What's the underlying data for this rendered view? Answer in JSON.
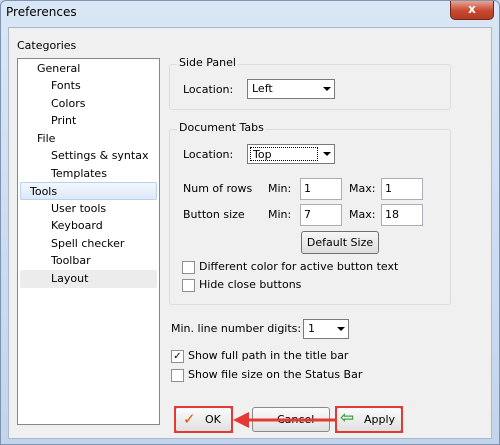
{
  "window": {
    "title": "Preferences",
    "close_glyph": "x"
  },
  "categories": {
    "label": "Categories",
    "items": [
      {
        "label": "General"
      },
      {
        "label": "Fonts"
      },
      {
        "label": "Colors"
      },
      {
        "label": "Print"
      },
      {
        "label": "File"
      },
      {
        "label": "Settings & syntax"
      },
      {
        "label": "Templates"
      },
      {
        "label": "Tools"
      },
      {
        "label": "User tools"
      },
      {
        "label": "Keyboard"
      },
      {
        "label": "Spell checker"
      },
      {
        "label": "Toolbar"
      },
      {
        "label": "Layout"
      }
    ]
  },
  "side_panel": {
    "title": "Side Panel",
    "location_label": "Location:",
    "location_value": "Left"
  },
  "document_tabs": {
    "title": "Document Tabs",
    "location_label": "Location:",
    "location_value": "Top",
    "num_rows_label": "Num of rows",
    "button_size_label": "Button size",
    "min_label": "Min:",
    "max_label": "Max:",
    "num_rows_min": "1",
    "num_rows_max": "1",
    "button_size_min": "7",
    "button_size_max": "18",
    "default_size_label": "Default Size",
    "different_color_label": "Different color for active button text",
    "different_color_checked": false,
    "hide_close_label": "Hide close buttons",
    "hide_close_checked": false
  },
  "line_digits": {
    "label": "Min. line number digits:",
    "value": "1"
  },
  "show_full_path": {
    "label": "Show full path in the title bar",
    "checked": true,
    "check_glyph": "✓"
  },
  "show_file_size": {
    "label": "Show file size on the Status Bar",
    "checked": false
  },
  "buttons": {
    "ok_label": "OK",
    "ok_glyph": "✓",
    "cancel_label": "Cancel",
    "apply_label": "Apply",
    "apply_glyph": "⇦"
  },
  "colors": {
    "annotation": "#e53935",
    "selection": "#dde9f8",
    "window_frame": "#c3d5ec"
  }
}
